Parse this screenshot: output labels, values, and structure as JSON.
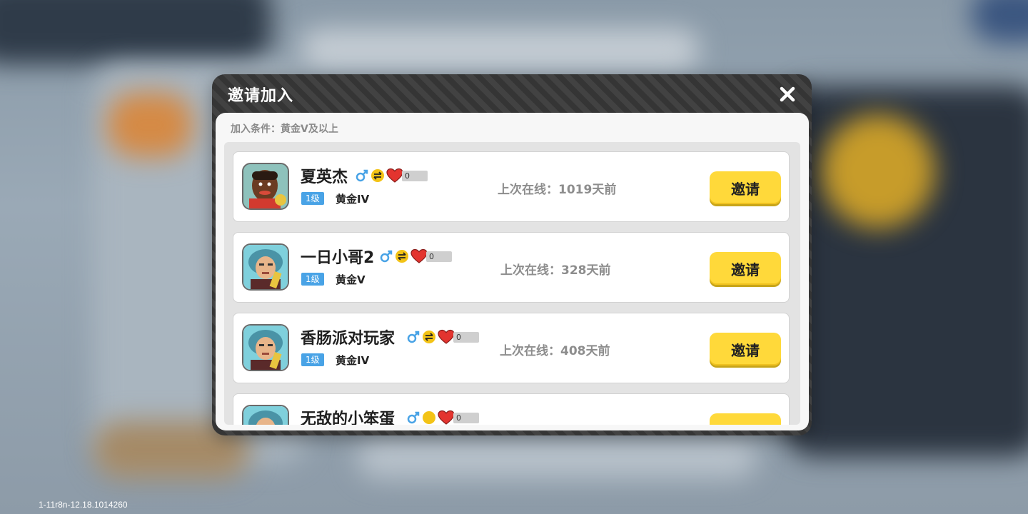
{
  "version_text": "1-11r8n-12.18.1014260",
  "dialog": {
    "title": "邀请加入",
    "close_icon": "close-icon",
    "condition": "加入条件：黄金V及以上"
  },
  "players": [
    {
      "name": "夏英杰",
      "likes": "0",
      "level": "1级",
      "rank": "黄金IV",
      "last_online": "上次在线：1019天前",
      "invite_label": "邀请",
      "avatar": "bearded-player-avatar"
    },
    {
      "name": "一日小哥2",
      "likes": "0",
      "level": "1级",
      "rank": "黄金V",
      "last_online": "上次在线：328天前",
      "invite_label": "邀请",
      "avatar": "wig-musician-avatar"
    },
    {
      "name": "香肠派对玩家",
      "likes": "0",
      "level": "1级",
      "rank": "黄金IV",
      "last_online": "上次在线：408天前",
      "invite_label": "邀请",
      "avatar": "wig-musician-avatar"
    },
    {
      "name": "无敌的小笨蛋",
      "likes": "0",
      "level": "",
      "rank": "",
      "last_online": "",
      "invite_label": "",
      "avatar": "wig-musician-avatar"
    }
  ],
  "colors": {
    "invite_button": "#ffd93a",
    "level_badge": "#49a3e6",
    "male_icon": "#49a3e6",
    "heart": "#e3342f"
  }
}
